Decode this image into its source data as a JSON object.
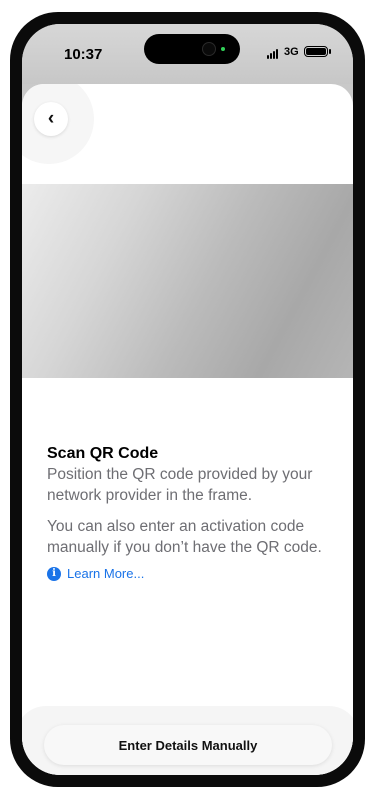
{
  "status_bar": {
    "time": "10:37",
    "network": "3G"
  },
  "navigation": {
    "back_icon": "chevron-left-icon",
    "back_glyph": "‹"
  },
  "scan": {
    "title": "Scan QR Code",
    "description": "Position the QR code provided by your network provider in the frame.",
    "manual_note": "You can also enter an activation code manually if you don’t have the QR code.",
    "learn_more": "Learn More...",
    "info_icon": "info-circle-icon"
  },
  "actions": {
    "manual_button": "Enter Details Manually"
  },
  "colors": {
    "link": "#1a73e8",
    "secondary_text": "#6e6e73"
  }
}
